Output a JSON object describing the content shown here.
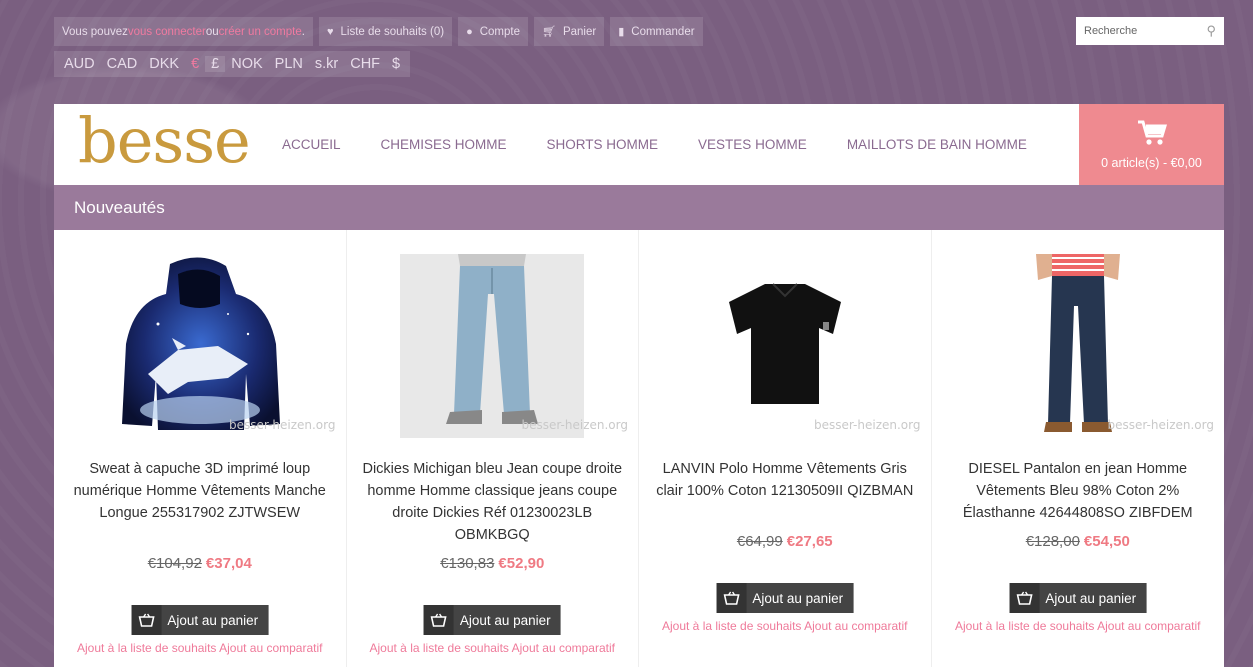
{
  "topbar": {
    "login_prefix": "Vous pouvez ",
    "login_link": "vous connecter",
    "login_mid": " ou ",
    "register_link": "créer un compte",
    "login_suffix": ".",
    "wishlist": "Liste de souhaits (0)",
    "account": "Compte",
    "cart": "Panier",
    "checkout": "Commander"
  },
  "currencies": [
    "AUD",
    "CAD",
    "DKK",
    "€",
    "£",
    "NOK",
    "PLN",
    "s.kr",
    "CHF",
    "$"
  ],
  "search": {
    "placeholder": "Recherche"
  },
  "logo": "besse",
  "nav": [
    "ACCUEIL",
    "CHEMISES HOMME",
    "SHORTS HOMME",
    "VESTES HOMME",
    "MAILLOTS DE BAIN HOMME"
  ],
  "cart": {
    "summary": "0 article(s) - €0,00"
  },
  "section_title": "Nouveautés",
  "watermark": "besser-heizen.org",
  "products": [
    {
      "title": "Sweat à capuche 3D imprimé loup numérique Homme Vêtements Manche Longue 255317902 ZJTWSEW",
      "old_price": "€104,92",
      "new_price": "€37,04",
      "button": "Ajout au panier",
      "wishlist": "Ajout à la liste de souhaits",
      "compare": "Ajout au comparatif",
      "image": "hoodie-wolf"
    },
    {
      "title": "Dickies Michigan bleu Jean coupe droite homme Homme classique jeans coupe droite Dickies Réf 01230023LB OBMKBGQ",
      "old_price": "€130,83",
      "new_price": "€52,90",
      "button": "Ajout au panier",
      "wishlist": "Ajout à la liste de souhaits",
      "compare": "Ajout au comparatif",
      "image": "jeans-light"
    },
    {
      "title": "LANVIN Polo Homme Vêtements Gris clair 100% Coton 12130509II QIZBMAN",
      "old_price": "€64,99",
      "new_price": "€27,65",
      "button": "Ajout au panier",
      "wishlist": "Ajout à la liste de souhaits",
      "compare": "Ajout au comparatif",
      "image": "polo-black"
    },
    {
      "title": "DIESEL Pantalon en jean Homme Vêtements Bleu 98% Coton 2% Élasthanne 42644808SO ZIBFDEM",
      "old_price": "€128,00",
      "new_price": "€54,50",
      "button": "Ajout au panier",
      "wishlist": "Ajout à la liste de souhaits",
      "compare": "Ajout au comparatif",
      "image": "jeans-dark"
    }
  ]
}
